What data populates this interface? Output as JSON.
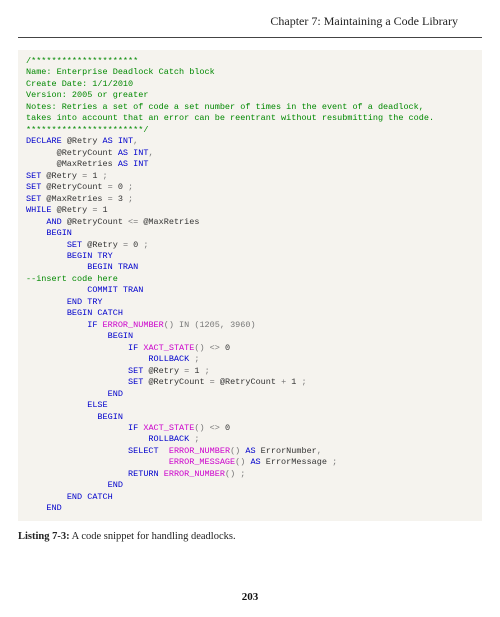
{
  "header": {
    "chapter": "Chapter 7: Maintaining a Code Library"
  },
  "code": {
    "l1": "/*********************",
    "l2": "Name: Enterprise Deadlock Catch block",
    "l3": "Create Date: 1/1/2010",
    "l4": "Version: 2005 or greater",
    "l5": "Notes: Retries a set of code a set number of times in the event of a deadlock,",
    "l6": "takes into account that an error can be reentrant without resubmitting the code.",
    "l7": "***********************/",
    "kw_declare": "DECLARE",
    "var_retry": " @Retry ",
    "kw_as": "AS",
    "ty_int": " INT",
    "comma": ",",
    "line_retrycount": "      @RetryCount ",
    "line_maxretries": "      @MaxRetries ",
    "kw_set": "SET",
    "set_retry_1": " @Retry ",
    "eq": "=",
    "val_1": " 1 ",
    "semi": ";",
    "set_retrycount_0": " @RetryCount ",
    "val_0": " 0 ",
    "set_maxretries_3": " @MaxRetries ",
    "val_3": " 3 ",
    "kw_while": "WHILE",
    "while_cond": " @Retry ",
    "kw_and_indent": "    ",
    "kw_and": "AND",
    "and_cond_l": " @RetryCount ",
    "op_le": "<=",
    "and_cond_r": " @MaxRetries",
    "kw_begin": "BEGIN",
    "indent4": "    ",
    "indent8": "        ",
    "indent12": "            ",
    "indent14": "              ",
    "indent16": "                ",
    "indent20": "                    ",
    "indent22": "                      ",
    "indent24": "                        ",
    "indent28": "                            ",
    "set_retry_0": " @Retry ",
    "kw_begin_try": "BEGIN TRY",
    "kw_begin_tran": "BEGIN TRAN",
    "comment_insert": "--insert code here",
    "kw_commit_tran": "COMMIT TRAN",
    "kw_end_try": "END TRY",
    "kw_begin_catch": "BEGIN CATCH",
    "kw_if": "IF",
    "fn_error_number": "ERROR_NUMBER",
    "paren_oc": "()",
    "kw_in": " IN ",
    "in_list": "(1205, 3960)",
    "fn_xact_state": "XACT_STATE",
    "neq": " <> ",
    "zero": "0",
    "kw_rollback": "ROLLBACK",
    "sp_semi": " ;",
    "set_retrycount_expr_l": " @RetryCount ",
    "set_retrycount_expr_r": " @RetryCount ",
    "plus": "+",
    "kw_end": "END",
    "kw_else": "ELSE",
    "kw_select": "SELECT",
    "two_sp": "  ",
    "as_errnum": " ErrorNumber",
    "fn_error_message": "ERROR_MESSAGE",
    "as_errmsg": " ErrorMessage ",
    "kw_return": "RETURN",
    "kw_end_catch": "END CATCH"
  },
  "caption": {
    "label": "Listing 7-3:",
    "text": "   A code snippet for handling deadlocks."
  },
  "page": {
    "number": "203"
  }
}
